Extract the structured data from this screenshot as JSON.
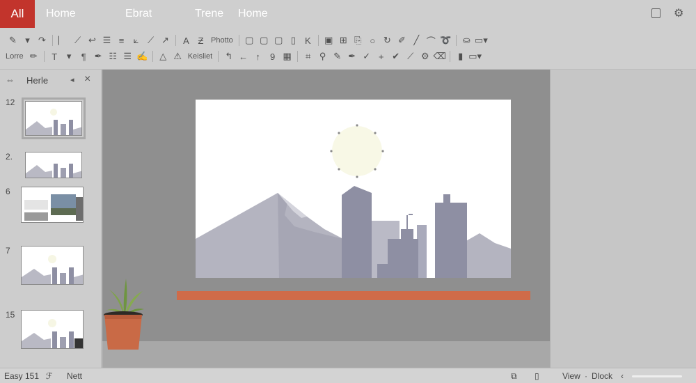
{
  "tabs": [
    {
      "label": "All",
      "active": true
    },
    {
      "label": "Home"
    },
    {
      "label": "Ebrat"
    },
    {
      "label": "Trene"
    },
    {
      "label": "Home"
    }
  ],
  "ribbon": {
    "row1_labels": [
      "Photto"
    ],
    "row2_labels": [
      "Lorre",
      "Keisliet"
    ]
  },
  "slides_panel": {
    "title": "Herle",
    "slide_numbers": [
      "12",
      "2.",
      "6",
      "7",
      "15"
    ]
  },
  "status_bar": {
    "left_text": "Easy 151",
    "left_text2": "Nett",
    "view_label": "View",
    "dock_label": "Dlock"
  },
  "colors": {
    "accent": "#c2342c",
    "shelf": "#cf6b49",
    "pot": "#c96a46",
    "building": "#8e8fa3",
    "mountain": "#b4b4c0",
    "sun": "#f8f8e6"
  }
}
